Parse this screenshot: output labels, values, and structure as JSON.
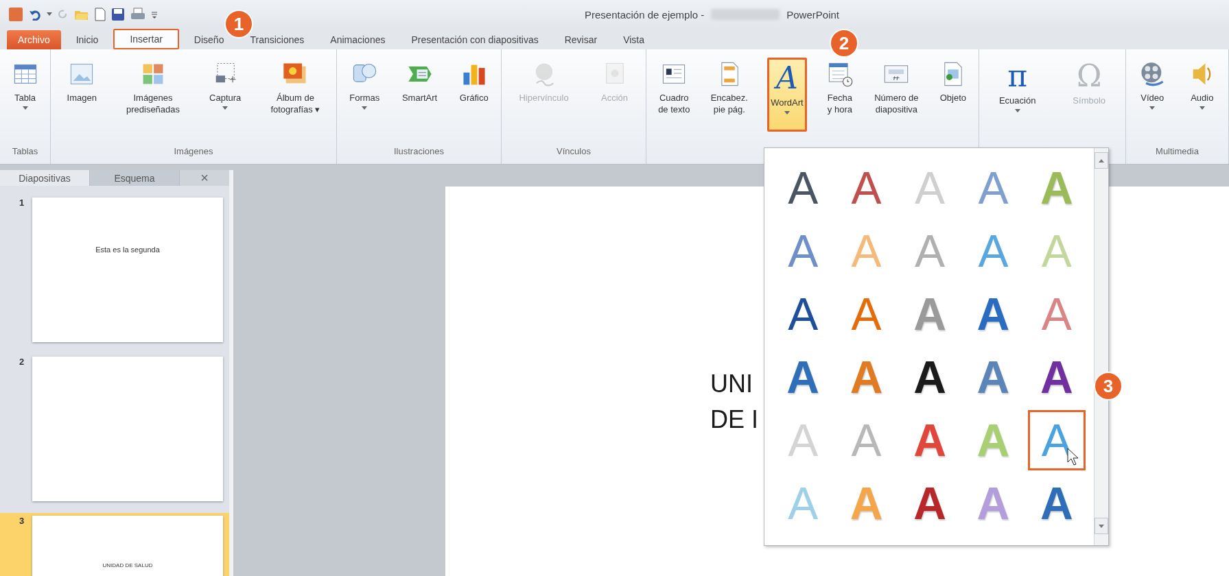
{
  "window": {
    "title": "Presentación de ejemplo -",
    "app_name": "PowerPoint"
  },
  "tabs": [
    {
      "label": "Archivo",
      "kind": "file",
      "selected": false
    },
    {
      "label": "Inicio",
      "kind": "tab",
      "selected": false
    },
    {
      "label": "Insertar",
      "kind": "tab",
      "selected": true
    },
    {
      "label": "Diseño",
      "kind": "tab",
      "selected": false
    },
    {
      "label": "Transiciones",
      "kind": "tab",
      "selected": false
    },
    {
      "label": "Animaciones",
      "kind": "tab",
      "selected": false
    },
    {
      "label": "Presentación con diapositivas",
      "kind": "tab",
      "selected": false
    },
    {
      "label": "Revisar",
      "kind": "tab",
      "selected": false
    },
    {
      "label": "Vista",
      "kind": "tab",
      "selected": false
    }
  ],
  "ribbon": {
    "groups": [
      {
        "label": "Tablas",
        "buttons": [
          {
            "label": "Tabla",
            "dropdown": true,
            "disabled": false,
            "selected": false
          }
        ]
      },
      {
        "label": "Imágenes",
        "buttons": [
          {
            "label": "Imagen",
            "dropdown": false,
            "disabled": false,
            "selected": false
          },
          {
            "label": "Imágenes\nprediseñadas",
            "dropdown": false,
            "disabled": false,
            "selected": false
          },
          {
            "label": "Captura",
            "dropdown": true,
            "disabled": false,
            "selected": false
          },
          {
            "label": "Álbum de\nfotografías ▾",
            "dropdown": false,
            "disabled": false,
            "selected": false
          }
        ]
      },
      {
        "label": "Ilustraciones",
        "buttons": [
          {
            "label": "Formas",
            "dropdown": true,
            "disabled": false,
            "selected": false
          },
          {
            "label": "SmartArt",
            "dropdown": false,
            "disabled": false,
            "selected": false
          },
          {
            "label": "Gráfico",
            "dropdown": false,
            "disabled": false,
            "selected": false
          }
        ]
      },
      {
        "label": "Vínculos",
        "buttons": [
          {
            "label": "Hipervínculo",
            "dropdown": false,
            "disabled": true,
            "selected": false
          },
          {
            "label": "Acción",
            "dropdown": false,
            "disabled": true,
            "selected": false
          }
        ]
      },
      {
        "buttons": [
          {
            "label": "Cuadro\nde texto",
            "dropdown": false,
            "disabled": false,
            "selected": false
          },
          {
            "label": "Encabez.\npie pág.",
            "dropdown": false,
            "disabled": false,
            "selected": false
          },
          {
            "label": "WordArt",
            "glyph": "A",
            "dropdown": true,
            "disabled": false,
            "selected": true
          },
          {
            "label": "Fecha\ny hora",
            "dropdown": false,
            "disabled": false,
            "selected": false
          },
          {
            "label": "Número de\ndiapositiva",
            "dropdown": false,
            "disabled": false,
            "selected": false
          },
          {
            "label": "Objeto",
            "dropdown": false,
            "disabled": false,
            "selected": false
          }
        ]
      },
      {
        "buttons": [
          {
            "label": "Ecuación",
            "glyph": "π",
            "dropdown": true,
            "disabled": false,
            "selected": false
          },
          {
            "label": "Símbolo",
            "glyph": "Ω",
            "dropdown": false,
            "disabled": true,
            "selected": false
          }
        ]
      },
      {
        "label": "Multimedia",
        "buttons": [
          {
            "label": "Vídeo",
            "dropdown": true,
            "disabled": false,
            "selected": false
          },
          {
            "label": "Audio",
            "dropdown": true,
            "disabled": false,
            "selected": false
          }
        ]
      }
    ]
  },
  "slides_panel": {
    "tabs": [
      {
        "label": "Diapositivas",
        "selected": true
      },
      {
        "label": "Esquema",
        "selected": false
      }
    ],
    "close": "×",
    "slides": [
      {
        "number": "1",
        "text": "Esta es la segunda",
        "selected": false
      },
      {
        "number": "2",
        "selected": false
      },
      {
        "number": "3",
        "text": "UNIDAD DE SALUD",
        "selected": true
      }
    ]
  },
  "slide": {
    "lines": [
      "UNI",
      "DE I"
    ]
  },
  "wordart_gallery": {
    "styles": [
      {
        "letter": "A",
        "kind": "outline",
        "color": "#4a5563",
        "selected": false
      },
      {
        "letter": "A",
        "kind": "outline",
        "color": "#c0504d",
        "selected": false
      },
      {
        "letter": "A",
        "kind": "outline",
        "color": "#cfcfcf",
        "selected": false
      },
      {
        "letter": "A",
        "kind": "outline",
        "color": "#7f9fcf",
        "selected": false
      },
      {
        "letter": "A",
        "kind": "solid",
        "color": "#9bbb59",
        "selected": false
      },
      {
        "letter": "A",
        "kind": "outline",
        "color": "#6f8fc8",
        "selected": false
      },
      {
        "letter": "A",
        "kind": "outline",
        "color": "#f5b97a",
        "selected": false
      },
      {
        "letter": "A",
        "kind": "outline",
        "color": "#b0b0b0",
        "selected": false
      },
      {
        "letter": "A",
        "kind": "outline",
        "color": "#5aa7e0",
        "selected": false
      },
      {
        "letter": "A",
        "kind": "outline",
        "color": "#c3d69b",
        "selected": false
      },
      {
        "letter": "A",
        "kind": "outline",
        "color": "#1f4e9a",
        "selected": false
      },
      {
        "letter": "A",
        "kind": "outline",
        "color": "#e46c0a",
        "selected": false
      },
      {
        "letter": "A",
        "kind": "solid",
        "color": "#9a9a9a",
        "selected": false
      },
      {
        "letter": "A",
        "kind": "solid",
        "color": "#2a6cbf",
        "selected": false
      },
      {
        "letter": "A",
        "kind": "outline",
        "color": "#d98585",
        "selected": false
      },
      {
        "letter": "A",
        "kind": "solid",
        "color": "#2f6fba",
        "selected": false
      },
      {
        "letter": "A",
        "kind": "solid",
        "color": "#e07b24",
        "selected": false
      },
      {
        "letter": "A",
        "kind": "solid",
        "color": "#1a1a1a",
        "selected": false
      },
      {
        "letter": "A",
        "kind": "solid",
        "color": "#5b84b8",
        "selected": false
      },
      {
        "letter": "A",
        "kind": "solid",
        "color": "#7030a0",
        "selected": false
      },
      {
        "letter": "A",
        "kind": "outline",
        "color": "#d4d4d4",
        "selected": false
      },
      {
        "letter": "A",
        "kind": "outline",
        "color": "#b8b8b8",
        "selected": false
      },
      {
        "letter": "A",
        "kind": "solid",
        "color": "#e0463c",
        "selected": false
      },
      {
        "letter": "A",
        "kind": "solid",
        "color": "#a8cf72",
        "selected": false
      },
      {
        "letter": "A",
        "kind": "outline",
        "color": "#4aa3df",
        "selected": true
      },
      {
        "letter": "A",
        "kind": "outline",
        "color": "#9fd0ea",
        "selected": false
      },
      {
        "letter": "A",
        "kind": "solid",
        "color": "#f5a54a",
        "selected": false
      },
      {
        "letter": "A",
        "kind": "solid",
        "color": "#b8282a",
        "selected": false
      },
      {
        "letter": "A",
        "kind": "solid",
        "color": "#b39ddb",
        "selected": false
      },
      {
        "letter": "A",
        "kind": "solid",
        "color": "#2e6db8",
        "selected": false
      }
    ]
  },
  "callouts": [
    {
      "label": "1"
    },
    {
      "label": "2"
    },
    {
      "label": "3"
    }
  ]
}
